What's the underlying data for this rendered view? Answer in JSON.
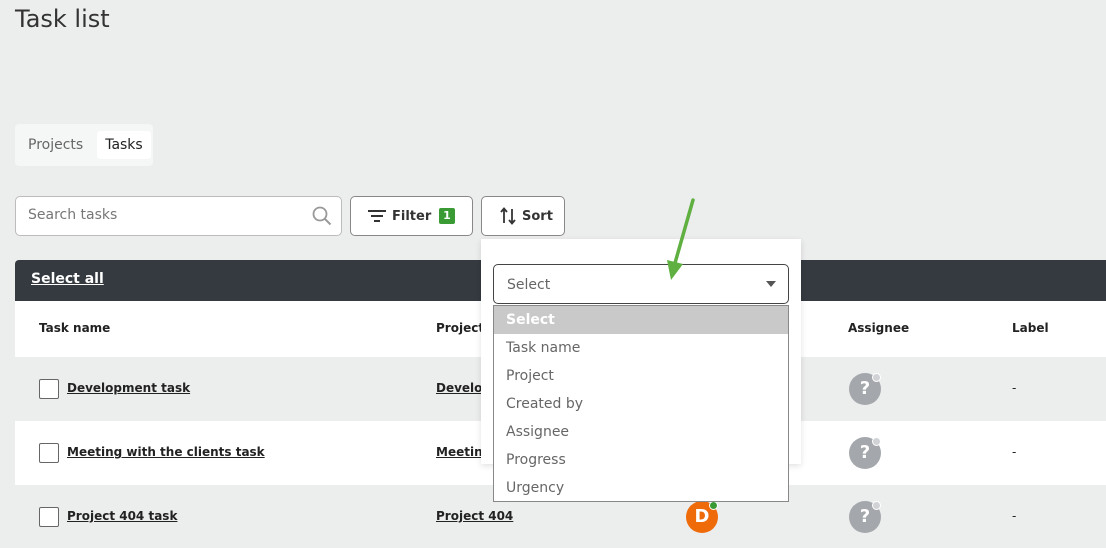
{
  "page": {
    "title": "Task list"
  },
  "tabs": [
    {
      "label": "Projects",
      "active": false
    },
    {
      "label": "Tasks",
      "active": true
    }
  ],
  "search": {
    "placeholder": "Search tasks",
    "value": ""
  },
  "toolbar": {
    "filter_label": "Filter",
    "filter_count": "1",
    "sort_label": "Sort"
  },
  "table": {
    "select_all": "Select all",
    "columns": [
      "Task name",
      "Project",
      "Assignee",
      "Label"
    ],
    "rows": [
      {
        "task": "Development task",
        "project": "Develop",
        "assignee": "?",
        "label": "-"
      },
      {
        "task": "Meeting with the clients task",
        "project": "Meeting",
        "assignee": "?",
        "label": "-"
      },
      {
        "task": "Project 404 task",
        "project": "Project 404",
        "creator": "D",
        "assignee": "?",
        "label": "-"
      }
    ]
  },
  "sort_dropdown": {
    "selected": "Select",
    "options": [
      "Select",
      "Task name",
      "Project",
      "Created by",
      "Assignee",
      "Progress",
      "Urgency"
    ]
  },
  "colors": {
    "accent_green": "#3a9b34",
    "header_dark": "#343a40",
    "avatar_orange": "#ef6a09"
  }
}
